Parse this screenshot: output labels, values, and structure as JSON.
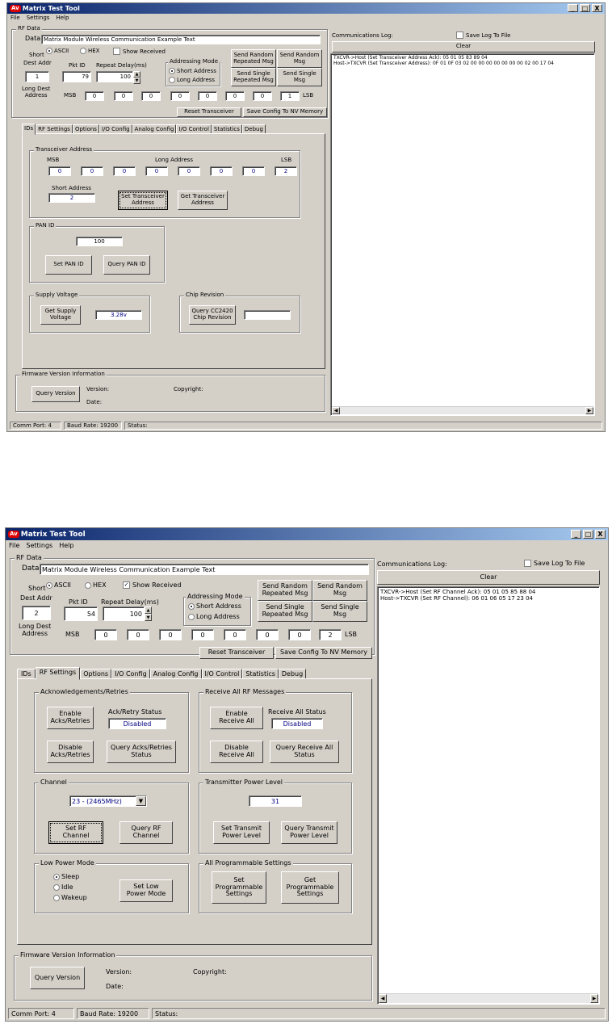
{
  "w1": {
    "title": "Matrix Test Tool",
    "logo": "Av",
    "controls": [
      "_",
      "□",
      "X"
    ],
    "menu": [
      "File",
      "Settings",
      "Help"
    ],
    "rf_data": {
      "legend": "RF Data",
      "data_label": "Data",
      "data_value": "Matrix Module Wireless Communication Example Text",
      "short_label": "Short",
      "dest_addr_label": "Dest Addr",
      "dest_addr_value": "1",
      "ascii_label": "ASCII",
      "hex_label": "HEX",
      "encoding_selected": "ASCII",
      "show_received_label": "Show Received",
      "show_received_checked": false,
      "pkt_id_label": "Pkt ID",
      "pkt_id_value": "79",
      "repeat_delay_label": "Repeat Delay(ms)",
      "repeat_delay_value": "100",
      "addressing_mode_label": "Addressing Mode",
      "short_address_label": "Short Address",
      "long_address_label": "Long Address",
      "addressing_selected": "Short Address",
      "send_random_repeated": "Send Random\nRepeated Msg",
      "send_random": "Send Random\nMsg",
      "send_single_repeated": "Send Single\nRepeated Msg",
      "send_single": "Send Single\nMsg",
      "long_dest_label": "Long Dest\nAddress",
      "msb_label": "MSB",
      "lsb_label": "LSB",
      "long_dest_bytes": [
        "0",
        "0",
        "0",
        "0",
        "0",
        "0",
        "0",
        "1"
      ],
      "reset_transceiver": "Reset Transceiver",
      "save_config": "Save Config To NV Memory"
    },
    "tabs": [
      "IDs",
      "RF Settings",
      "Options",
      "I/O Config",
      "Analog Config",
      "I/O Control",
      "Statistics",
      "Debug"
    ],
    "active_tab": "IDs",
    "ids_tab": {
      "transceiver_legend": "Transceiver Address",
      "msb_label": "MSB",
      "long_address_label": "Long Address",
      "lsb_label": "LSB",
      "long_bytes": [
        "0",
        "0",
        "0",
        "0",
        "0",
        "0",
        "0",
        "2"
      ],
      "short_address_label": "Short Address",
      "short_address_value": "2",
      "set_transceiver": "Set Transceiver\nAddress",
      "get_transceiver": "Get Transceiver\nAddress",
      "pan_legend": "PAN ID",
      "pan_value": "100",
      "set_pan": "Set PAN ID",
      "query_pan": "Query PAN ID",
      "supply_legend": "Supply Voltage",
      "get_supply": "Get Supply\nVoltage",
      "supply_value": "3.28v",
      "chip_legend": "Chip Revision",
      "query_chip": "Query CC2420\nChip Revision",
      "chip_value": ""
    },
    "firmware": {
      "legend": "Firmware Version Information",
      "query_version": "Query Version",
      "version_label": "Version:",
      "copyright_label": "Copyright:",
      "date_label": "Date:"
    },
    "log": {
      "label": "Communications Log:",
      "save_label": "Save Log To File",
      "save_checked": false,
      "clear": "Clear",
      "lines": [
        "TXCVR->Host (Set Transceiver Address Ack): 05 01 05 83 89 04",
        "Host->TXCVR (Set Transceiver Address): 0F 01 0F 03 02 00 00 00 00 00 00 00 02 00 17 04"
      ]
    },
    "status": {
      "comm_port": "Comm Port: 4",
      "baud_rate": "Baud Rate: 19200",
      "status": "Status:"
    }
  },
  "w2": {
    "title": "Matrix Test Tool",
    "logo": "Av",
    "controls": [
      "_",
      "□",
      "X"
    ],
    "menu": [
      "File",
      "Settings",
      "Help"
    ],
    "rf_data": {
      "legend": "RF Data",
      "data_label": "Data",
      "data_value": "Matrix Module Wireless Communication Example Text",
      "short_label": "Short",
      "dest_addr_label": "Dest Addr",
      "dest_addr_value": "2",
      "ascii_label": "ASCII",
      "hex_label": "HEX",
      "encoding_selected": "ASCII",
      "show_received_label": "Show Received",
      "show_received_checked": true,
      "pkt_id_label": "Pkt ID",
      "pkt_id_value": "54",
      "repeat_delay_label": "Repeat Delay(ms)",
      "repeat_delay_value": "100",
      "addressing_mode_label": "Addressing Mode",
      "short_address_label": "Short Address",
      "long_address_label": "Long Address",
      "addressing_selected": "Short Address",
      "send_random_repeated": "Send Random\nRepeated Msg",
      "send_random": "Send Random\nMsg",
      "send_single_repeated": "Send Single\nRepeated Msg",
      "send_single": "Send Single\nMsg",
      "long_dest_label": "Long Dest\nAddress",
      "msb_label": "MSB",
      "lsb_label": "LSB",
      "long_dest_bytes": [
        "0",
        "0",
        "0",
        "0",
        "0",
        "0",
        "0",
        "2"
      ],
      "reset_transceiver": "Reset Transceiver",
      "save_config": "Save Config To NV Memory"
    },
    "tabs": [
      "IDs",
      "RF Settings",
      "Options",
      "I/O Config",
      "Analog Config",
      "I/O Control",
      "Statistics",
      "Debug"
    ],
    "active_tab": "RF Settings",
    "rf_tab": {
      "ack_legend": "Acknowledgements/Retries",
      "enable_acks": "Enable\nAcks/Retries",
      "ack_status_label": "Ack/Retry Status",
      "ack_status_value": "Disabled",
      "disable_acks": "Disable\nAcks/Retries",
      "query_acks": "Query Acks/Retries\nStatus",
      "receive_legend": "Receive All RF Messages",
      "enable_receive": "Enable\nReceive All",
      "receive_status_label": "Receive All Status",
      "receive_status_value": "Disabled",
      "disable_receive": "Disable\nReceive All",
      "query_receive": "Query Receive All\nStatus",
      "channel_legend": "Channel",
      "channel_value": "23 - (2465MHz)",
      "set_channel": "Set RF\nChannel",
      "query_channel": "Query RF\nChannel",
      "power_legend": "Transmitter Power Level",
      "power_value": "31",
      "set_power": "Set Transmit\nPower Level",
      "query_power": "Query Transmit\nPower Level",
      "lowpower_legend": "Low Power Mode",
      "lowpower_options": [
        "Sleep",
        "Idle",
        "Wakeup"
      ],
      "lowpower_selected": "Sleep",
      "set_lowpower": "Set Low\nPower Mode",
      "prog_legend": "All Programmable Settings",
      "set_prog": "Set\nProgrammable\nSettings",
      "get_prog": "Get\nProgrammable\nSettings"
    },
    "firmware": {
      "legend": "Firmware Version Information",
      "query_version": "Query Version",
      "version_label": "Version:",
      "copyright_label": "Copyright:",
      "date_label": "Date:"
    },
    "log": {
      "label": "Communications Log:",
      "save_label": "Save Log To File",
      "save_checked": false,
      "clear": "Clear",
      "lines": [
        "TXCVR->Host (Set RF Channel Ack): 05 01 05 85 88 04",
        "Host->TXCVR (Set RF Channel): 06 01 06 05 17 23 04"
      ]
    },
    "status": {
      "comm_port": "Comm Port: 4",
      "baud_rate": "Baud Rate: 19200",
      "status": "Status:"
    }
  }
}
